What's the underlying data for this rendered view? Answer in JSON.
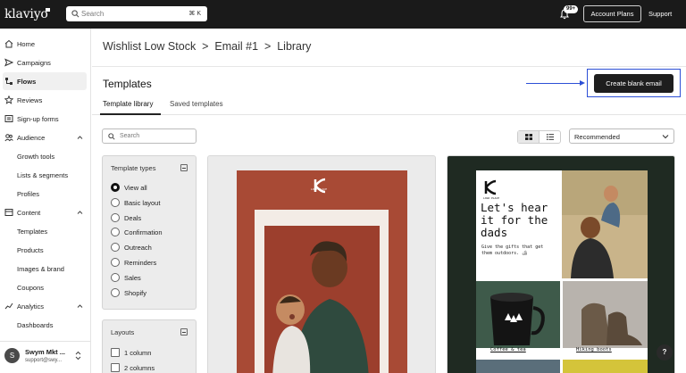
{
  "topbar": {
    "logo": "klaviyo",
    "search_placeholder": "Search",
    "search_shortcut": "⌘ K",
    "notification_count": "99+",
    "account_plans": "Account Plans",
    "support": "Support"
  },
  "sidebar": {
    "items": [
      {
        "label": "Home",
        "icon": "home-icon"
      },
      {
        "label": "Campaigns",
        "icon": "campaigns-icon"
      },
      {
        "label": "Flows",
        "icon": "flows-icon"
      },
      {
        "label": "Reviews",
        "icon": "star-icon"
      },
      {
        "label": "Sign-up forms",
        "icon": "form-icon"
      },
      {
        "label": "Audience",
        "icon": "audience-icon"
      },
      {
        "label": "Growth tools"
      },
      {
        "label": "Lists & segments"
      },
      {
        "label": "Profiles"
      },
      {
        "label": "Content",
        "icon": "content-icon"
      },
      {
        "label": "Templates"
      },
      {
        "label": "Products"
      },
      {
        "label": "Images & brand"
      },
      {
        "label": "Coupons"
      },
      {
        "label": "Analytics",
        "icon": "analytics-icon"
      },
      {
        "label": "Dashboards"
      }
    ],
    "user": {
      "initial": "S",
      "name": "Swym Mkt ...",
      "email": "support@swy..."
    }
  },
  "main": {
    "breadcrumb": "Wishlist Low Stock  >  Email #1  >  Library",
    "title": "Templates",
    "create_button": "Create blank email",
    "tabs": [
      {
        "label": "Template library",
        "active": true
      },
      {
        "label": "Saved templates",
        "active": false
      }
    ],
    "search_placeholder": "Search",
    "sort_value": "Recommended",
    "filters": {
      "template_types_title": "Template types",
      "template_types": [
        "View all",
        "Basic layout",
        "Deals",
        "Confirmation",
        "Outreach",
        "Reminders",
        "Sales",
        "Shopify"
      ],
      "selected": "View all",
      "layouts_title": "Layouts",
      "layouts": [
        "1 column",
        "2 columns"
      ]
    }
  },
  "template2": {
    "brand_small": "LOGO PLACE",
    "headline_1": "Let's hear",
    "headline_2": "it for the",
    "headline_3": "dads",
    "subtext": "Give the gifts that get them outdoors. 🏕",
    "caption_1": "Coffee & tea",
    "caption_2": "Hiking boots"
  },
  "template1": {
    "brand_small": "LOGO PLACE"
  },
  "colors": {
    "topbar": "#1a1a1a",
    "accent_blue": "#2c4fd6",
    "card1_bg": "#a84a35",
    "card2_bg": "#1f2a22"
  },
  "help_label": "?"
}
